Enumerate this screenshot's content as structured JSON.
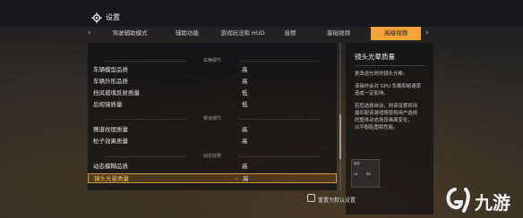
{
  "window": {
    "title": "设置",
    "gear_icon": "gear-icon"
  },
  "tabs": [
    {
      "label": "驾驶辅助模式"
    },
    {
      "label": "辅助功能"
    },
    {
      "label": "游戏玩法和 HUD"
    },
    {
      "label": "音频"
    },
    {
      "label": "基础视频"
    },
    {
      "label": "高级视频",
      "active": true
    }
  ],
  "sections": {
    "vehicle": "车辆细节",
    "track": "赛道细节",
    "dynamic": "动态效果"
  },
  "settings": [
    {
      "label": "车辆模型品质",
      "value": "高"
    },
    {
      "label": "车辆外形品质",
      "value": "高"
    },
    {
      "label": "挡风玻璃反射质量",
      "value": "低"
    },
    {
      "label": "后视镜质量",
      "value": "低"
    },
    {
      "label": "赛道纹理质量",
      "value": "高"
    },
    {
      "label": "粒子效果质量",
      "value": "高"
    },
    {
      "label": "动态模糊品质",
      "value": "高"
    },
    {
      "label": "镜头光晕质量",
      "value": "高",
      "selected": true
    }
  ],
  "info": {
    "title": "镜头光晕质量",
    "lines": [
      "更改逆光时的镜头光晕。",
      "该操作会对 GPU 负载和帧速率",
      "造成一定影响。",
      "若您选择自动，则该设置将用",
      "最匹配该游戏情景和用户选择",
      "的整体动态场景画面变化，",
      "以平衡贴图和性能。"
    ],
    "mini_labels": [
      "较好",
      "LB",
      "RB"
    ]
  },
  "footer": {
    "reset_label": "重置为默认设置"
  },
  "watermark": {
    "text": "九游"
  },
  "colors": {
    "accent": "#f2a33a",
    "selected_text": "#ffc66a"
  }
}
